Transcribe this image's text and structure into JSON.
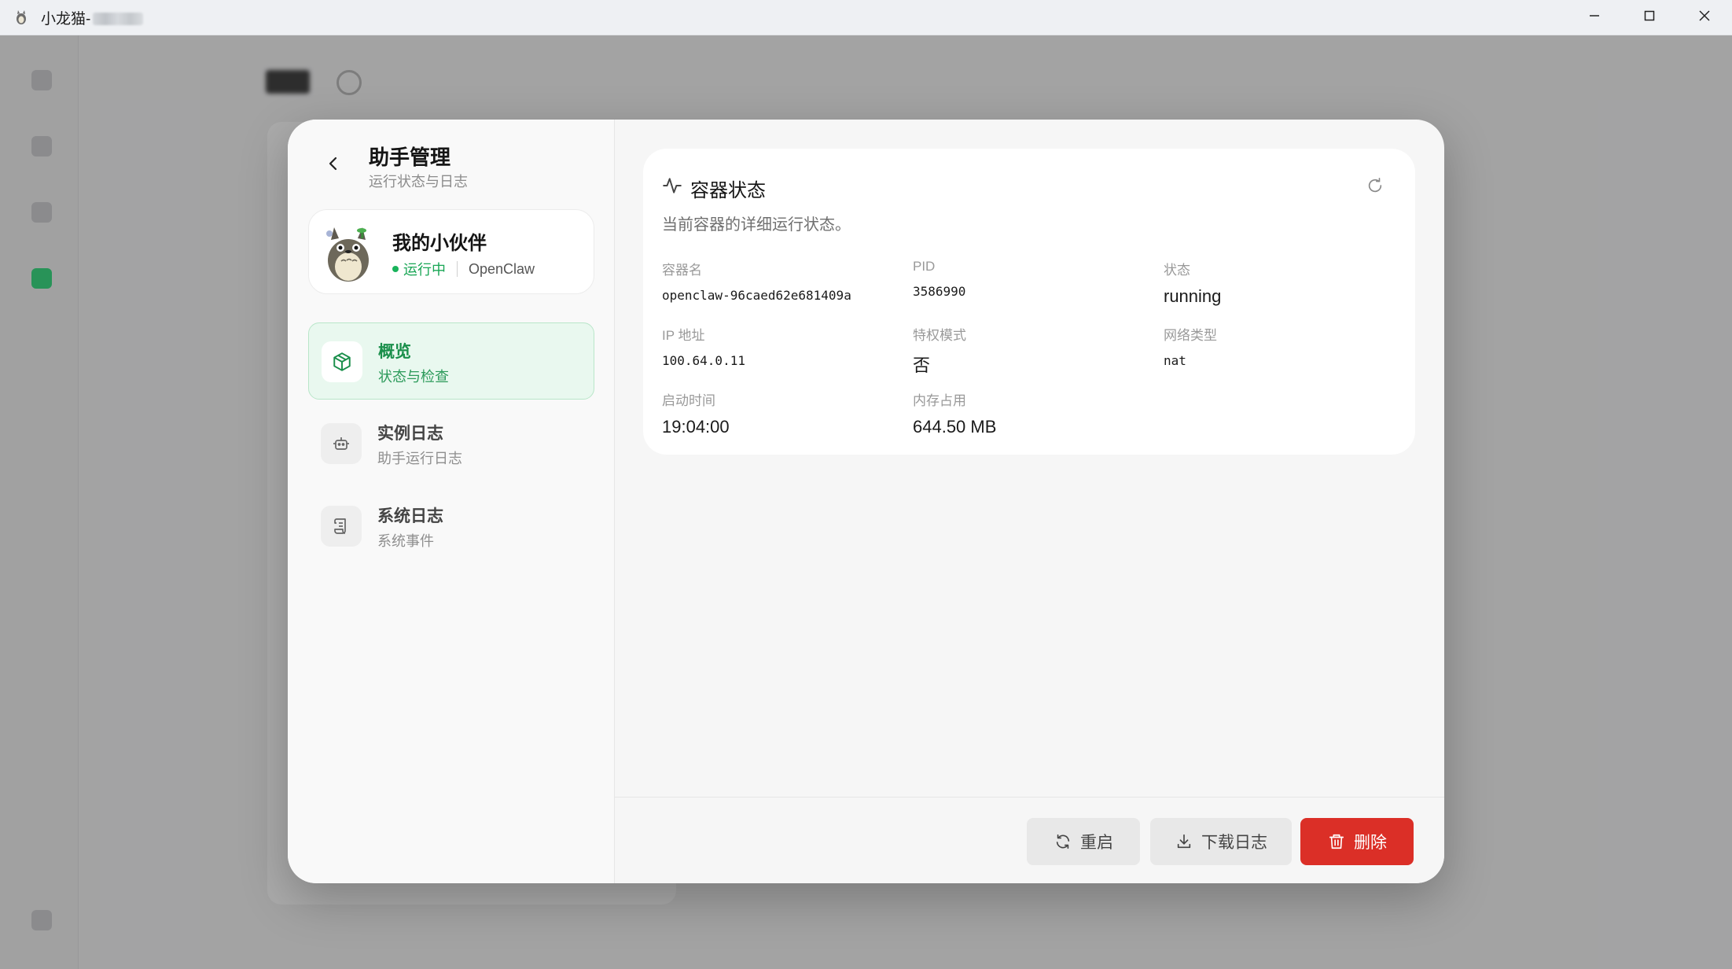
{
  "window": {
    "title": "小龙猫-",
    "minimize_icon": "minimize-icon",
    "maximize_icon": "maximize-icon",
    "close_icon": "close-icon"
  },
  "background": {
    "heading_icon": "settings-icon"
  },
  "sidebar": {
    "title": "助手管理",
    "subtitle": "运行状态与日志",
    "back_icon": "chevron-left-icon",
    "profile": {
      "name": "我的小伙伴",
      "status": "运行中",
      "status_color": "#19a655",
      "product": "OpenClaw"
    },
    "nav": [
      {
        "title": "概览",
        "subtitle": "状态与检查",
        "icon": "cube-icon",
        "active": true
      },
      {
        "title": "实例日志",
        "subtitle": "助手运行日志",
        "icon": "robot-icon",
        "active": false
      },
      {
        "title": "系统日志",
        "subtitle": "系统事件",
        "icon": "scroll-icon",
        "active": false
      }
    ]
  },
  "status_card": {
    "title": "容器状态",
    "description": "当前容器的详细运行状态。",
    "icon": "activity-icon",
    "refresh_icon": "refresh-icon",
    "fields": {
      "container_name": {
        "label": "容器名",
        "value": "openclaw-96caed62e681409a"
      },
      "pid": {
        "label": "PID",
        "value": "3586990"
      },
      "state": {
        "label": "状态",
        "value": "running"
      },
      "ip": {
        "label": "IP 地址",
        "value": "100.64.0.11"
      },
      "privileged": {
        "label": "特权模式",
        "value": "否"
      },
      "network": {
        "label": "网络类型",
        "value": "nat"
      },
      "start_time": {
        "label": "启动时间",
        "value": "19:04:00"
      },
      "memory": {
        "label": "内存占用",
        "value": "644.50 MB"
      }
    }
  },
  "footer": {
    "restart_label": "重启",
    "download_label": "下载日志",
    "delete_label": "删除",
    "delete_color": "#db2f27",
    "accent": "#19b35b"
  }
}
